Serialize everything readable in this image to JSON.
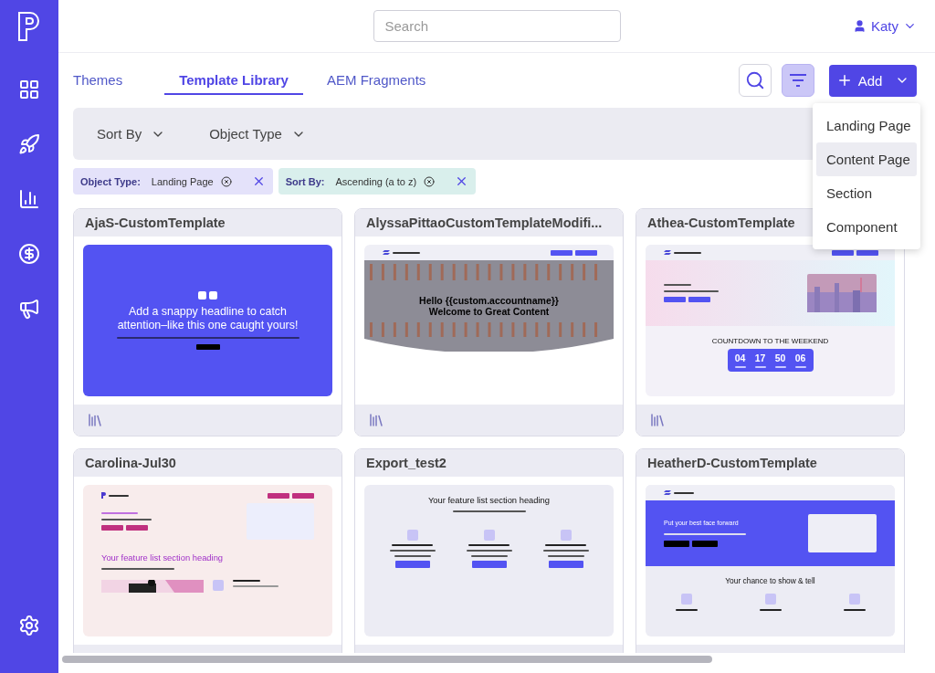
{
  "search": {
    "placeholder": "Search"
  },
  "user": {
    "name": "Katy"
  },
  "tabs": [
    {
      "label": "Themes",
      "selected": false
    },
    {
      "label": "Template Library",
      "selected": true
    },
    {
      "label": "AEM Fragments",
      "selected": false
    }
  ],
  "filter_button": {
    "selected": true
  },
  "add_button": {
    "label": "Add"
  },
  "add_menu": {
    "items": [
      {
        "label": "Landing Page",
        "selected": false
      },
      {
        "label": "Content Page",
        "selected": true
      },
      {
        "label": "Section",
        "selected": false
      },
      {
        "label": "Component",
        "selected": false
      }
    ]
  },
  "filter_bar": {
    "dropdowns": [
      "Sort By",
      "Object Type"
    ]
  },
  "chips": [
    {
      "key": "Object Type:",
      "value": "Landing Page",
      "color": "#e4e2fa"
    },
    {
      "key": "Sort By:",
      "value": "Ascending (a to z)",
      "color": "#d9efec"
    }
  ],
  "cards": [
    {
      "title": "AjaS-CustomTemplate",
      "thumbnail": {
        "kind": "hero_solid",
        "headline": "Add a snappy headline to catch attention–like this one caught yours!"
      }
    },
    {
      "title": "AlyssaPittaoCustomTemplateModifi...",
      "thumbnail": {
        "kind": "hero_dark",
        "headline": [
          "Hello {{custom.accountname}}",
          "Welcome to Great Content"
        ]
      }
    },
    {
      "title": "Athea-CustomTemplate",
      "thumbnail": {
        "kind": "countdown",
        "title": "COUNTDOWN TO THE WEEKEND",
        "values": [
          "04",
          "17",
          "50",
          "06"
        ]
      }
    },
    {
      "title": "Carolina-Jul30",
      "thumbnail": {
        "kind": "feature_pink",
        "heading": "Your feature list section heading"
      }
    },
    {
      "title": "Export_test2",
      "thumbnail": {
        "kind": "features",
        "heading": "Your feature list section heading"
      }
    },
    {
      "title": "HeatherD-CustomTemplate",
      "thumbnail": {
        "kind": "benefits",
        "hero_heading": "Put your best face forward",
        "heading": "Your chance to show & tell"
      }
    }
  ]
}
